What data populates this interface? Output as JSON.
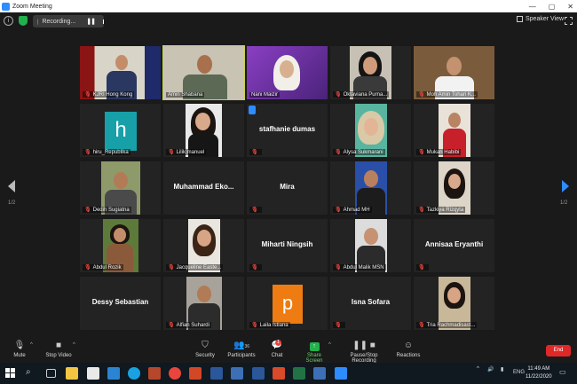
{
  "window": {
    "title": "Zoom Meeting",
    "controls": [
      "—",
      "▢",
      "✕"
    ]
  },
  "topbar": {
    "recording_label": "Recording...",
    "speaker_view_label": "Speaker View"
  },
  "pager": {
    "left": "1/2",
    "right": "1/2"
  },
  "participants": [
    {
      "label": "KJRI Hong Kong"
    },
    {
      "label": "Amin Shabana"
    },
    {
      "label": "Nani Maizir"
    },
    {
      "label": "Oktaviana Purna..."
    },
    {
      "label": "Moh Amin Tohari K..."
    },
    {
      "label": "hiru_Republika",
      "logo": "h"
    },
    {
      "label": "Lilik manuel"
    },
    {
      "label": "",
      "center_name": "stafhanie dumas"
    },
    {
      "label": "Alysa Sukmarani"
    },
    {
      "label": "Mukan Habibi"
    },
    {
      "label": "Dedih Sugiatna"
    },
    {
      "label": "",
      "center_name": "Muhammad Eko..."
    },
    {
      "label": "",
      "center_name": "Mira"
    },
    {
      "label": "Ahmad MH"
    },
    {
      "label": "Tazkiya Rizqyta"
    },
    {
      "label": "Abdul Rozik"
    },
    {
      "label": "Jacqueline Easte..."
    },
    {
      "label": "",
      "center_name": "Miharti Ningsih"
    },
    {
      "label": "Abdul Malik MSN"
    },
    {
      "label": "",
      "center_name": "Annisaa Eryanthi"
    },
    {
      "label": "",
      "center_name": "Dessy Sebastian"
    },
    {
      "label": "Alfian Suhardi"
    },
    {
      "label": "Laila Istiana",
      "logo": "p"
    },
    {
      "label": "",
      "center_name": "Isna Sofara"
    },
    {
      "label": "Tria Rachmadisast..."
    }
  ],
  "toolbar": {
    "mute": "Mute",
    "stop_video": "Stop Video",
    "security": "Security",
    "participants": "Participants",
    "participants_count": "36",
    "chat": "Chat",
    "chat_badge": "1",
    "share_screen": "Share Screen",
    "record": "Pause/Stop Recording",
    "reactions": "Reactions",
    "end": "End"
  },
  "taskbar": {
    "lang": "ENG",
    "time": "11:49 AM",
    "date": "11/22/2020"
  },
  "colors": {
    "active_speaker": "#c9d34b",
    "end": "#e02828",
    "share": "#23b14d",
    "accent": "#2d8cff"
  }
}
